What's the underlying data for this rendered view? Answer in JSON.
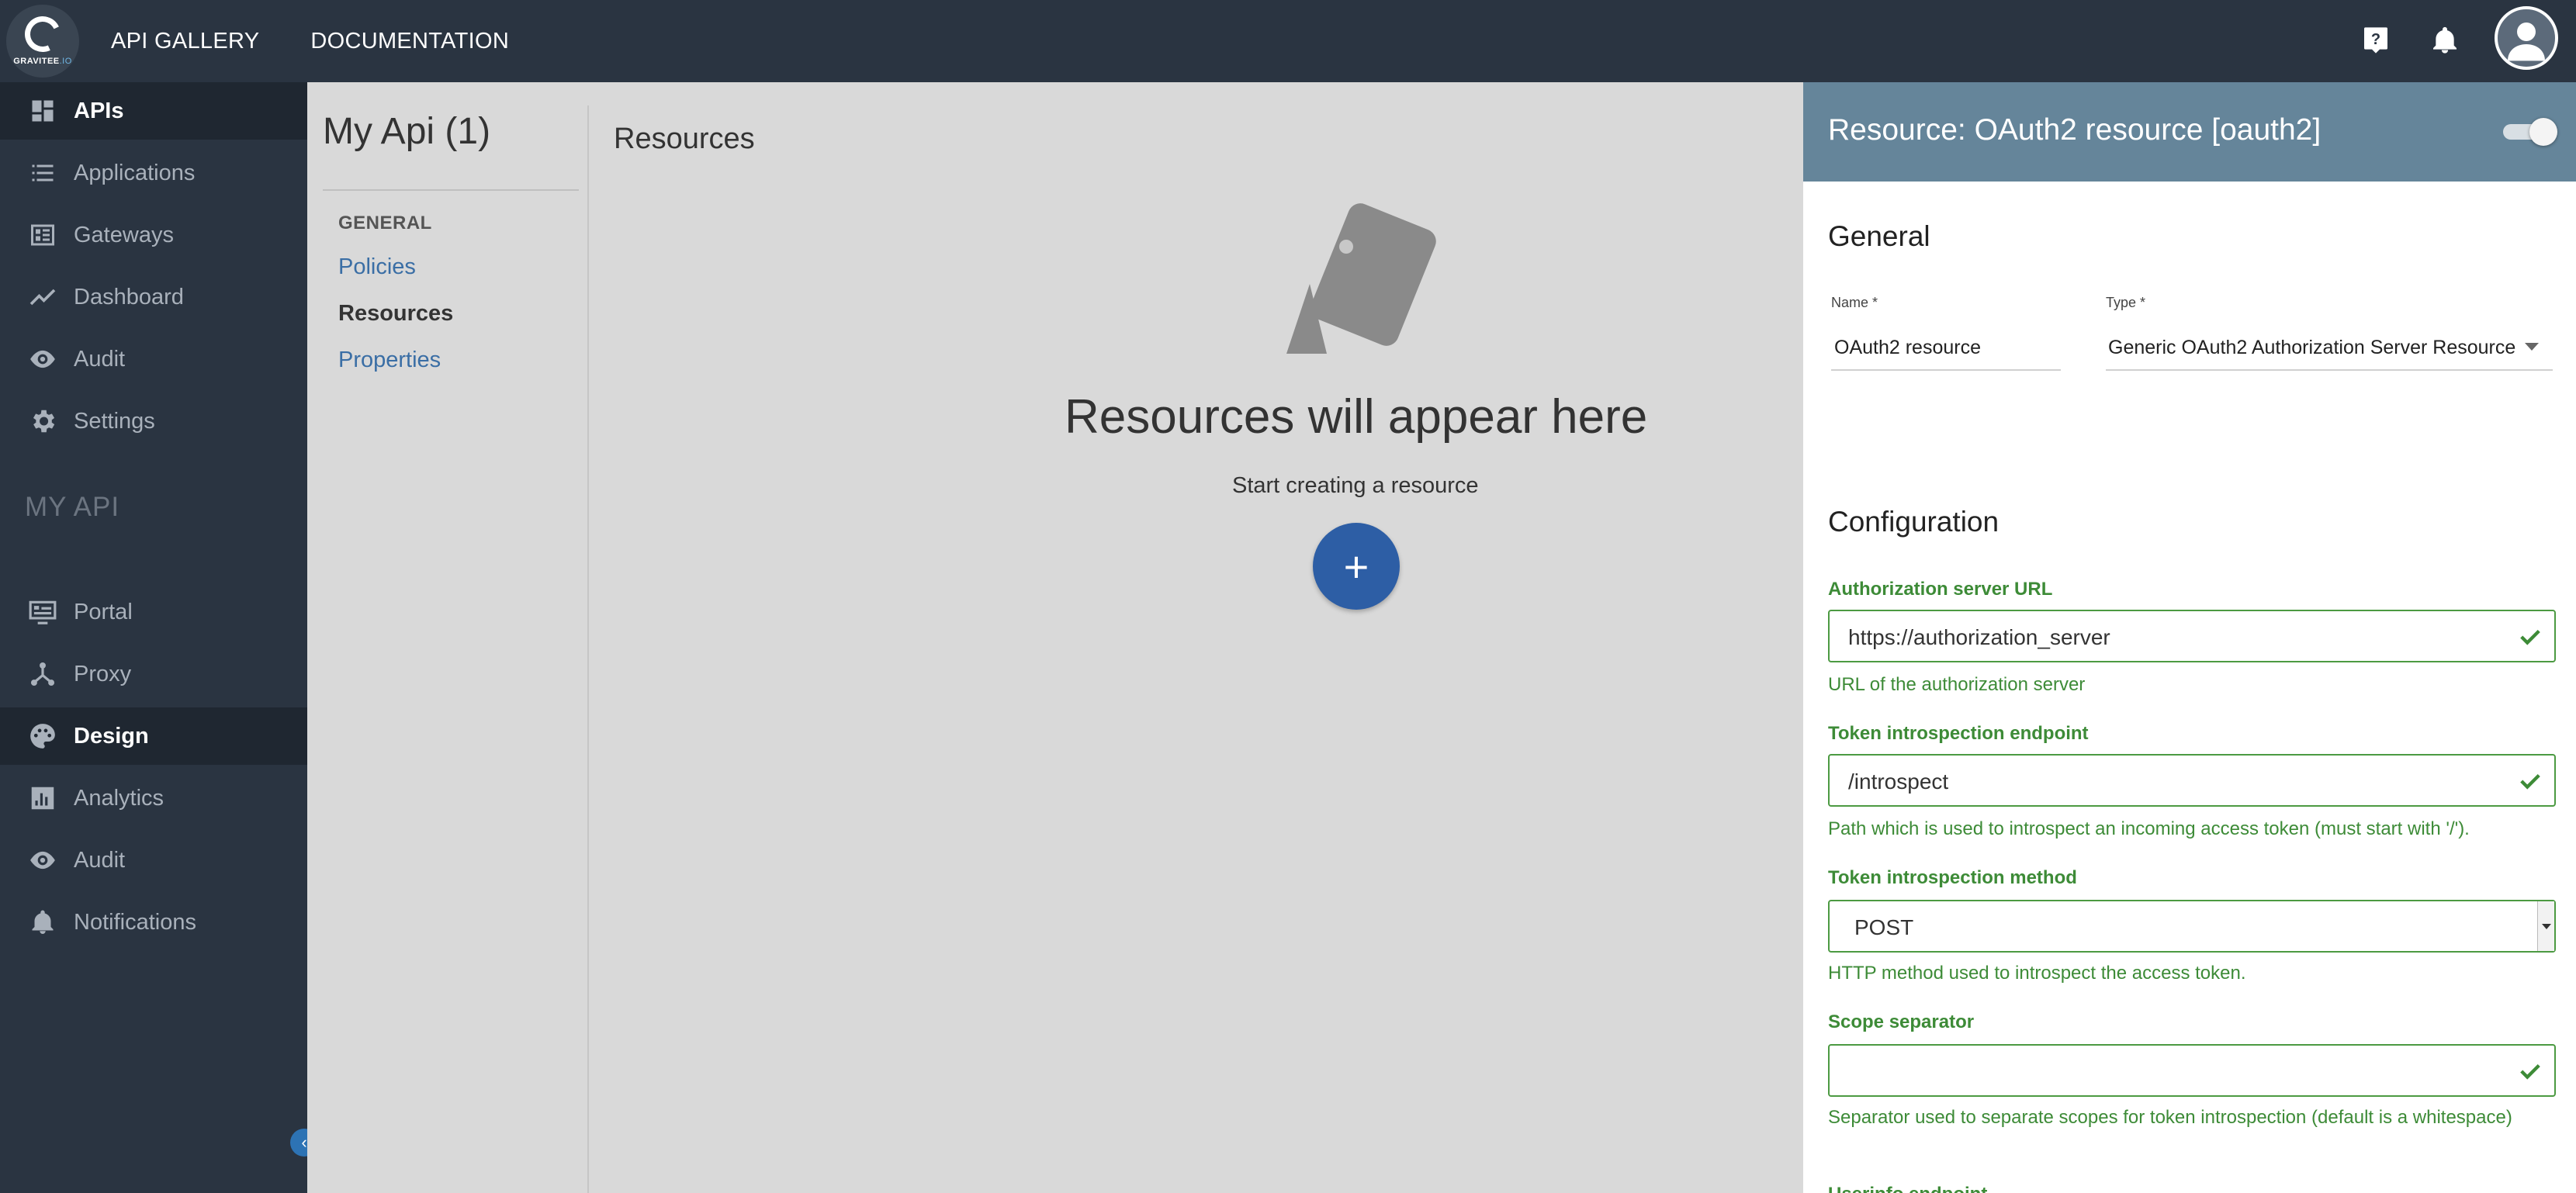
{
  "topbar": {
    "logo_text_a": "GRAVITEE",
    "logo_text_b": ".IO",
    "nav": [
      "API GALLERY",
      "DOCUMENTATION"
    ]
  },
  "sidebar": {
    "items": [
      {
        "label": "APIs",
        "icon": "dashboard-icon"
      },
      {
        "label": "Applications",
        "icon": "list-icon"
      },
      {
        "label": "Gateways",
        "icon": "gateway-icon"
      },
      {
        "label": "Dashboard",
        "icon": "trending-icon"
      },
      {
        "label": "Audit",
        "icon": "eye-icon"
      },
      {
        "label": "Settings",
        "icon": "gear-icon"
      }
    ],
    "section": "MY API",
    "api_items": [
      {
        "label": "Portal",
        "icon": "portal-icon"
      },
      {
        "label": "Proxy",
        "icon": "proxy-icon"
      },
      {
        "label": "Design",
        "icon": "palette-icon"
      },
      {
        "label": "Analytics",
        "icon": "chart-icon"
      },
      {
        "label": "Audit",
        "icon": "eye-icon"
      },
      {
        "label": "Notifications",
        "icon": "bell-icon"
      }
    ]
  },
  "main": {
    "api_title": "My Api (1)",
    "nav_section": "GENERAL",
    "nav_links": [
      "Policies",
      "Resources",
      "Properties"
    ],
    "content_title": "Resources",
    "empty_title": "Resources will appear here",
    "empty_sub": "Start creating a resource",
    "fab_label": "+"
  },
  "panel": {
    "title": "Resource: OAuth2 resource [oauth2]",
    "general_heading": "General",
    "name_label": "Name *",
    "name_value": "OAuth2 resource",
    "type_label": "Type *",
    "type_value": "Generic OAuth2 Authorization Server Resource",
    "config_heading": "Configuration",
    "fields": [
      {
        "label": "Authorization server URL",
        "value": "https://authorization_server",
        "help": "URL of the authorization server"
      },
      {
        "label": "Token introspection endpoint",
        "value": "/introspect",
        "help": "Path which is used to introspect an incoming access token (must start with '/')."
      },
      {
        "label": "Token introspection method",
        "value": "POST",
        "help": "HTTP method used to introspect the access token."
      },
      {
        "label": "Scope separator",
        "value": "",
        "help": "Separator used to separate scopes for token introspection (default is a whitespace)"
      }
    ],
    "cut_label": "Userinfo endpoint"
  },
  "colors": {
    "topbar": "#2a3441",
    "panel_header": "#65859a",
    "valid_green": "#3d8b37",
    "fab_blue": "#2d5ea5"
  }
}
